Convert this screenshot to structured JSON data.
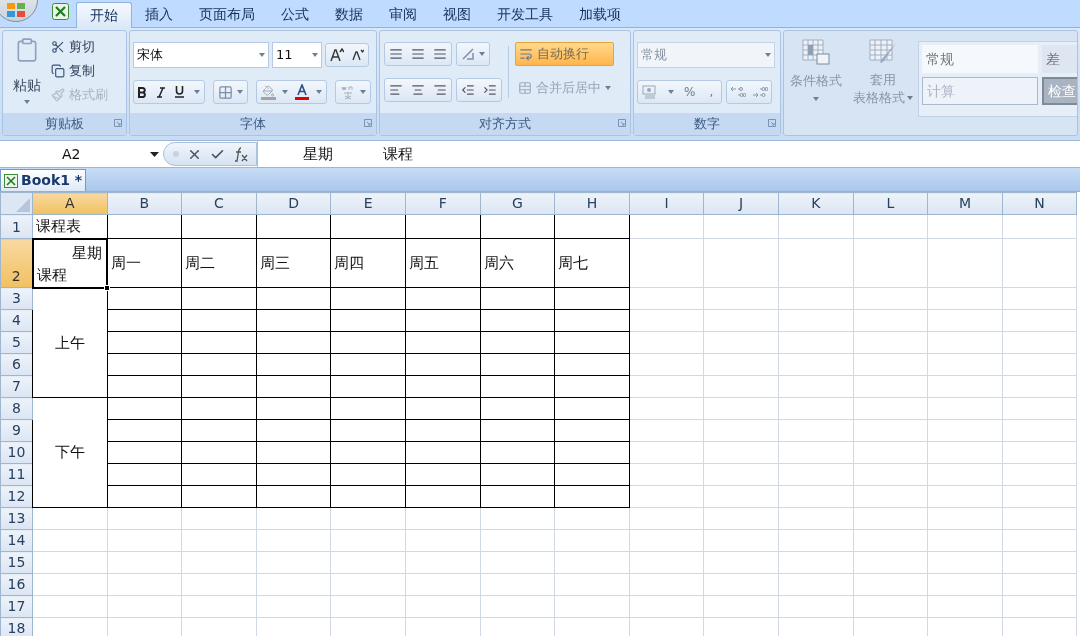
{
  "tabs": [
    {
      "label": "开始",
      "selected": true
    },
    {
      "label": "插入",
      "selected": false
    },
    {
      "label": "页面布局",
      "selected": false
    },
    {
      "label": "公式",
      "selected": false
    },
    {
      "label": "数据",
      "selected": false
    },
    {
      "label": "审阅",
      "selected": false
    },
    {
      "label": "视图",
      "selected": false
    },
    {
      "label": "开发工具",
      "selected": false
    },
    {
      "label": "加载项",
      "selected": false
    }
  ],
  "ribbon": {
    "clipboard": {
      "title": "剪贴板",
      "paste": "粘贴",
      "items": [
        {
          "label": "剪切",
          "disabled": false
        },
        {
          "label": "复制",
          "disabled": false
        },
        {
          "label": "格式刷",
          "disabled": true
        }
      ]
    },
    "font": {
      "title": "字体",
      "font_name": "宋体",
      "font_size": "11"
    },
    "alignment": {
      "title": "对齐方式",
      "wrap_text": {
        "label": "自动换行",
        "selected": true
      },
      "merge": {
        "label": "合并后居中",
        "disabled": true
      }
    },
    "number": {
      "title": "数字",
      "format": "常规",
      "percent": "%",
      "comma": ","
    },
    "styles": {
      "conditional": "条件格式",
      "table_format": [
        "套用",
        "表格格式"
      ],
      "cell_styles": [
        {
          "label": "常规",
          "kind": "normal"
        },
        {
          "label": "差",
          "kind": "bad"
        },
        {
          "label": "计算",
          "kind": "calc"
        },
        {
          "label": "检查",
          "kind": "check"
        }
      ]
    }
  },
  "formula_bar": {
    "name_box": "A2",
    "content": [
      "星期",
      "课程"
    ]
  },
  "sheet_tab": "Book1 *",
  "sheet": {
    "columns": [
      {
        "label": "A",
        "selected": true
      },
      {
        "label": "B",
        "selected": false
      },
      {
        "label": "C",
        "selected": false
      },
      {
        "label": "D",
        "selected": false
      },
      {
        "label": "E",
        "selected": false
      },
      {
        "label": "F",
        "selected": false
      },
      {
        "label": "G",
        "selected": false
      },
      {
        "label": "H",
        "selected": false
      },
      {
        "label": "I",
        "selected": false
      },
      {
        "label": "J",
        "selected": false
      },
      {
        "label": "K",
        "selected": false
      },
      {
        "label": "L",
        "selected": false
      },
      {
        "label": "M",
        "selected": false
      },
      {
        "label": "N",
        "selected": false
      }
    ],
    "rows": [
      {
        "label": "1",
        "selected": false
      },
      {
        "label": "2",
        "selected": true
      },
      {
        "label": "3",
        "selected": false
      },
      {
        "label": "4",
        "selected": false
      },
      {
        "label": "5",
        "selected": false
      },
      {
        "label": "6",
        "selected": false
      },
      {
        "label": "7",
        "selected": false
      },
      {
        "label": "8",
        "selected": false
      },
      {
        "label": "9",
        "selected": false
      },
      {
        "label": "10",
        "selected": false
      },
      {
        "label": "11",
        "selected": false
      },
      {
        "label": "12",
        "selected": false
      },
      {
        "label": "13",
        "selected": false
      },
      {
        "label": "14",
        "selected": false
      },
      {
        "label": "15",
        "selected": false
      },
      {
        "label": "16",
        "selected": false
      },
      {
        "label": "17",
        "selected": false
      },
      {
        "label": "18",
        "selected": false
      }
    ],
    "title_cell": "课程表",
    "corner_cell": {
      "top": "星期",
      "bottom": "课程"
    },
    "days": [
      "周一",
      "周二",
      "周三",
      "周四",
      "周五",
      "周六",
      "周七"
    ],
    "periods": [
      "上午",
      "下午"
    ]
  }
}
